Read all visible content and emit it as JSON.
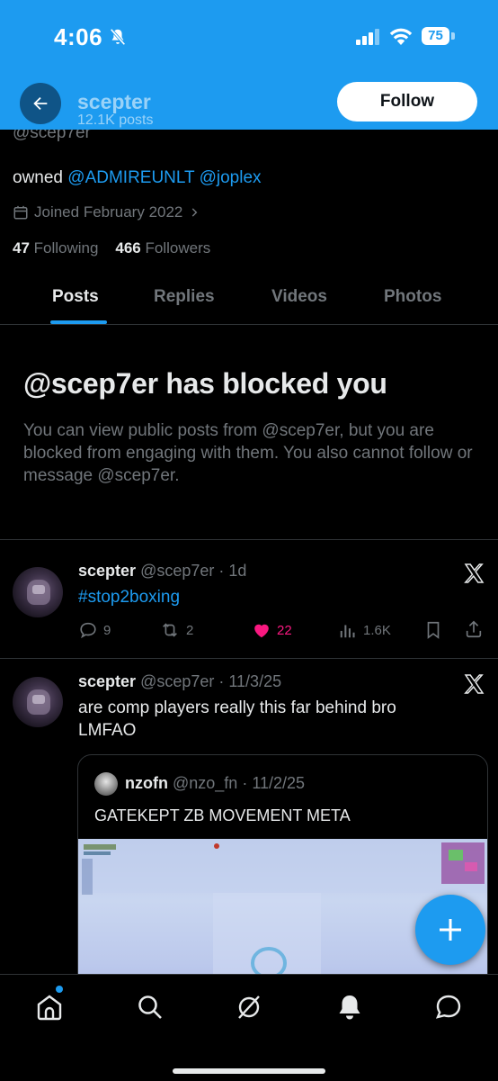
{
  "status_bar": {
    "time": "4:06",
    "battery": "75"
  },
  "header": {
    "name": "scepter",
    "posts_count": "12.1K posts",
    "follow_label": "Follow"
  },
  "profile": {
    "handle": "@scep7er",
    "bio_prefix": "owned ",
    "bio_mention_1": "@ADMIREUNLT",
    "bio_mention_2": "@joplex",
    "joined": "Joined February 2022",
    "following_count": "47",
    "following_label": "Following",
    "followers_count": "466",
    "followers_label": "Followers"
  },
  "tabs": [
    "Posts",
    "Replies",
    "Videos",
    "Photos"
  ],
  "blocked": {
    "title": "@scep7er has blocked you",
    "body": "You can view public posts from @scep7er, but you are blocked from engaging with them. You also cannot follow or message @scep7er."
  },
  "posts": [
    {
      "name": "scepter",
      "handle": "@scep7er",
      "time": "1d",
      "text": "#stop2boxing",
      "replies": "9",
      "reposts": "2",
      "likes": "22",
      "views": "1.6K"
    },
    {
      "name": "scepter",
      "handle": "@scep7er",
      "time": "11/3/25",
      "text": "are comp players really this far behind bro LMFAO",
      "quote": {
        "name": "nzofn",
        "handle": "@nzo_fn",
        "time": "11/2/25",
        "text": "GATEKEPT ZB MOVEMENT META"
      }
    }
  ],
  "colors": {
    "accent": "#1d9bf0",
    "like": "#f91880",
    "muted": "#71767b",
    "background": "#000000"
  },
  "icons": {
    "bottom_nav": [
      "home-icon",
      "search-icon",
      "grok-icon",
      "notifications-icon",
      "messages-icon"
    ]
  }
}
